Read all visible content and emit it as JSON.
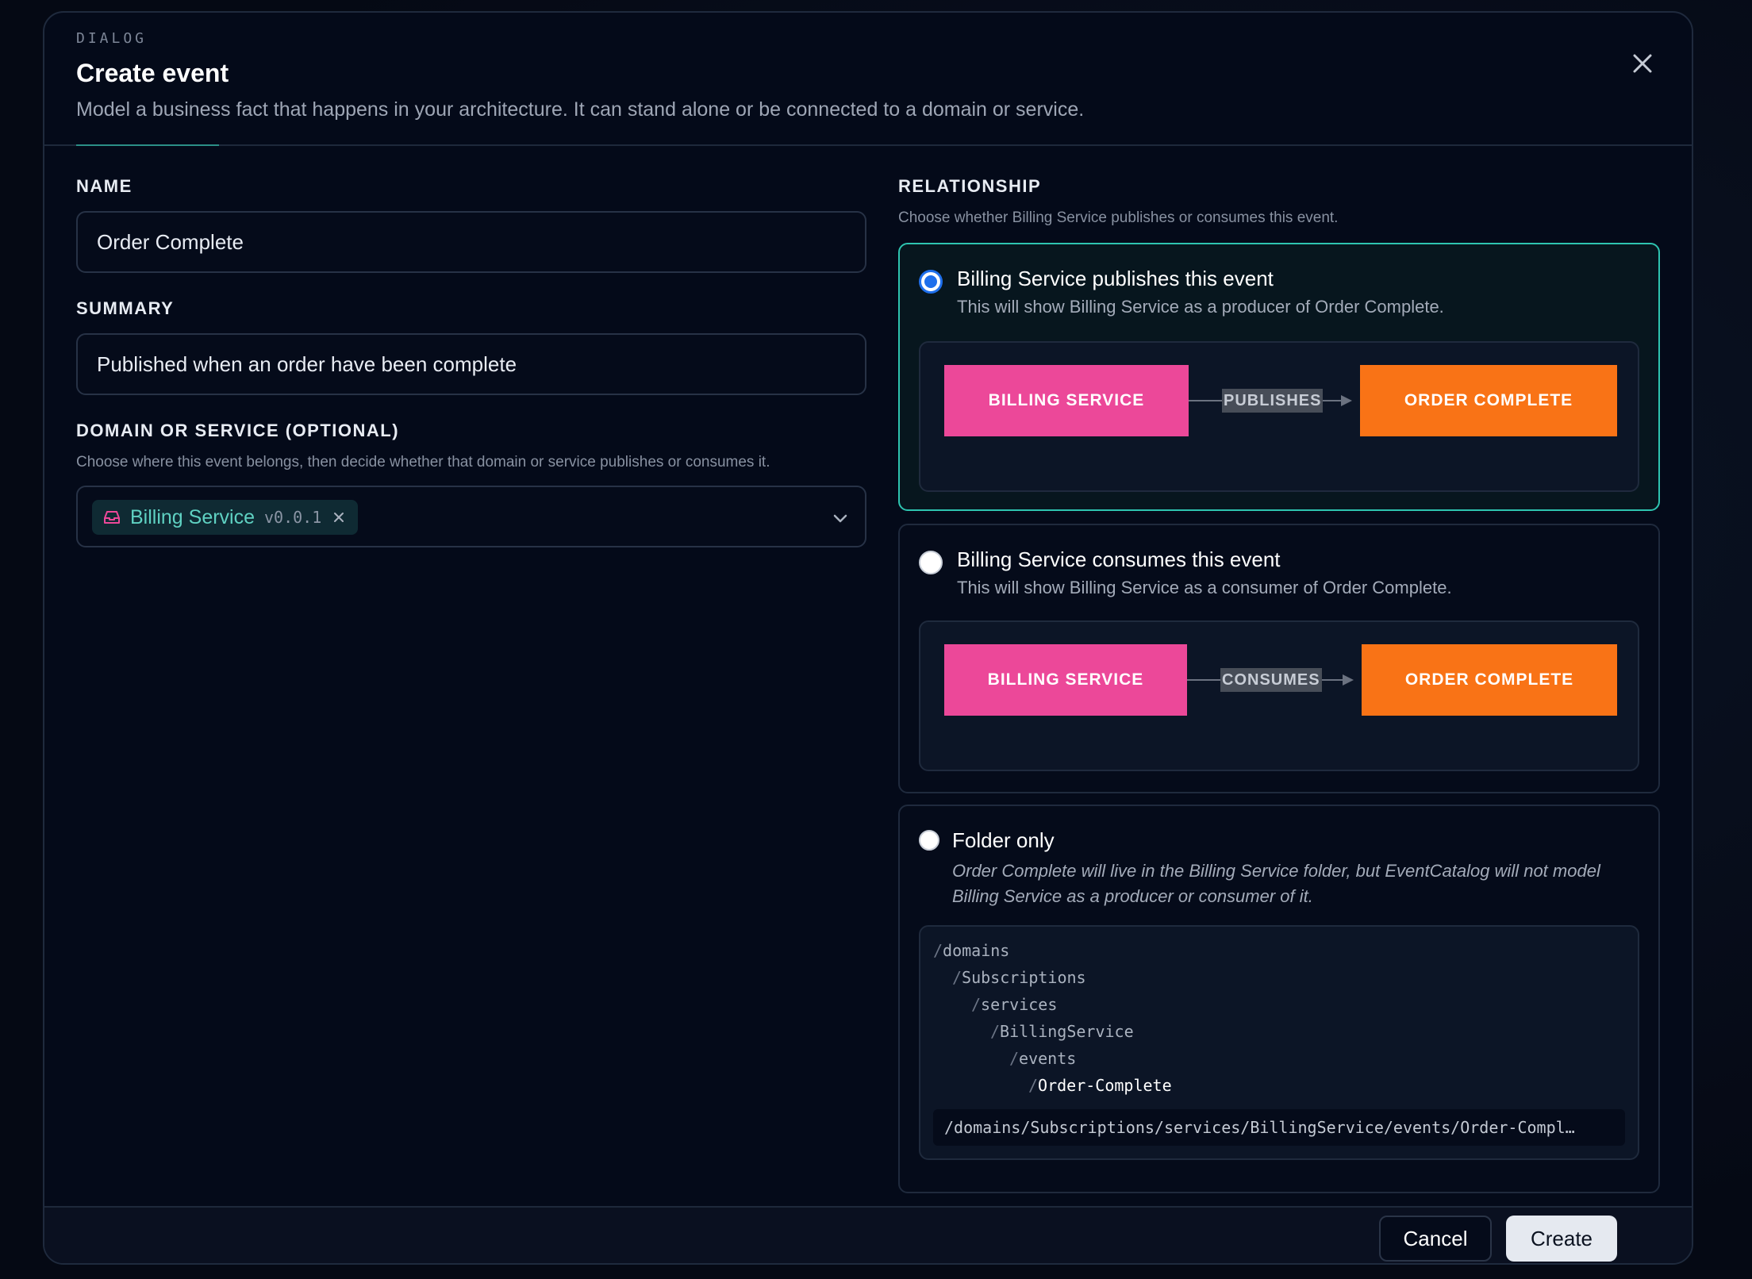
{
  "dialog": {
    "eyebrow": "DIALOG",
    "title": "Create event",
    "subtitle": "Model a business fact that happens in your architecture. It can stand alone or be connected to a domain or service."
  },
  "form": {
    "name": {
      "label": "NAME",
      "value": "Order Complete"
    },
    "summary": {
      "label": "SUMMARY",
      "value": "Published when an order have been complete"
    },
    "domain": {
      "label": "DOMAIN OR SERVICE (OPTIONAL)",
      "help": "Choose where this event belongs, then decide whether that domain or service publishes or consumes it.",
      "selected": {
        "name": "Billing Service",
        "version": "v0.0.1"
      }
    }
  },
  "relationship": {
    "label": "RELATIONSHIP",
    "help": "Choose whether Billing Service publishes or consumes this event.",
    "options": [
      {
        "title": "Billing Service publishes this event",
        "desc": "This will show Billing Service as a producer of Order Complete.",
        "selected": true,
        "source": "BILLING SERVICE",
        "edge": "PUBLISHES",
        "target": "ORDER COMPLETE"
      },
      {
        "title": "Billing Service consumes this event",
        "desc": "This will show Billing Service as a consumer of Order Complete.",
        "selected": false,
        "source": "BILLING SERVICE",
        "edge": "CONSUMES",
        "target": "ORDER COMPLETE"
      },
      {
        "title": "Folder only",
        "desc": "Order Complete will live in the Billing Service folder, but EventCatalog will not model Billing Service as a producer or consumer of it.",
        "selected": false,
        "tree": [
          "domains",
          "Subscriptions",
          "services",
          "BillingService",
          "events",
          "Order-Complete"
        ],
        "full_path": "/domains/Subscriptions/services/BillingService/events/Order-Compl…"
      }
    ]
  },
  "footer": {
    "cancel": "Cancel",
    "create": "Create"
  },
  "colors": {
    "accent": "#2ec4b0",
    "service": "#ec4899",
    "event": "#f97316",
    "radio_selected": "#1f6feb"
  },
  "icons": {
    "close": "close-icon",
    "service": "service-icon",
    "remove": "remove-icon",
    "chevron": "chevron-down-icon"
  }
}
